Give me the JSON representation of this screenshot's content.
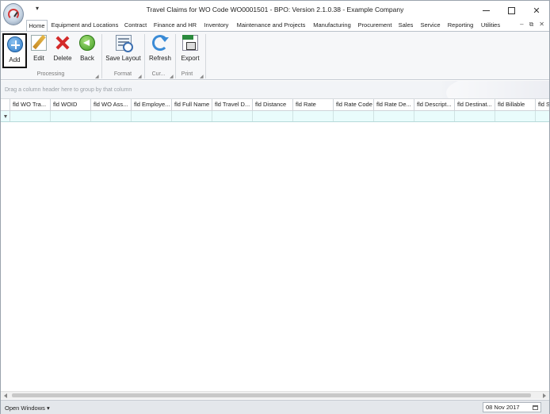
{
  "window": {
    "title": "Travel Claims for WO Code WO0001501 - BPO: Version 2.1.0.38 - Example Company",
    "qat_glyph": "▾",
    "close_glyph": "✕"
  },
  "tabs": [
    {
      "label": "Home",
      "active": true
    },
    {
      "label": "Equipment and Locations"
    },
    {
      "label": "Contract"
    },
    {
      "label": "Finance and HR"
    },
    {
      "label": "Inventory"
    },
    {
      "label": "Maintenance and Projects"
    },
    {
      "label": "Manufacturing"
    },
    {
      "label": "Procurement"
    },
    {
      "label": "Sales"
    },
    {
      "label": "Service"
    },
    {
      "label": "Reporting"
    },
    {
      "label": "Utilities"
    }
  ],
  "mdi_glyphs": {
    "minimize": "–",
    "restore": "⧉",
    "close": "✕"
  },
  "ribbon": {
    "buttons": {
      "add": "Add",
      "edit": "Edit",
      "delete": "Delete",
      "back": "Back",
      "save_layout": "Save Layout",
      "refresh": "Refresh",
      "export": "Export"
    },
    "groups": {
      "processing": "Processing",
      "format": "Format",
      "current": "Cur...",
      "print": "Print"
    }
  },
  "group_panel": {
    "hint": "Drag a column header here to group by that column"
  },
  "grid": {
    "columns": [
      "fld WO Tra...",
      "fld WOID",
      "fld WO Ass...",
      "fld Employe...",
      "fld Full Name",
      "fld Travel D...",
      "fld Distance",
      "fld Rate",
      "fld Rate Code",
      "fld Rate De...",
      "fld Descript...",
      "fld Destinat...",
      "fld Billable",
      "fld S"
    ]
  },
  "statusbar": {
    "open_windows": "Open Windows ▾",
    "date": "08 Nov 2017"
  },
  "colors": {
    "accent_blue": "#2a78c8",
    "filter_row": "#e9fcfc",
    "ribbon_bg": "#f6f7f9",
    "status_bg": "#e4e7eb"
  }
}
